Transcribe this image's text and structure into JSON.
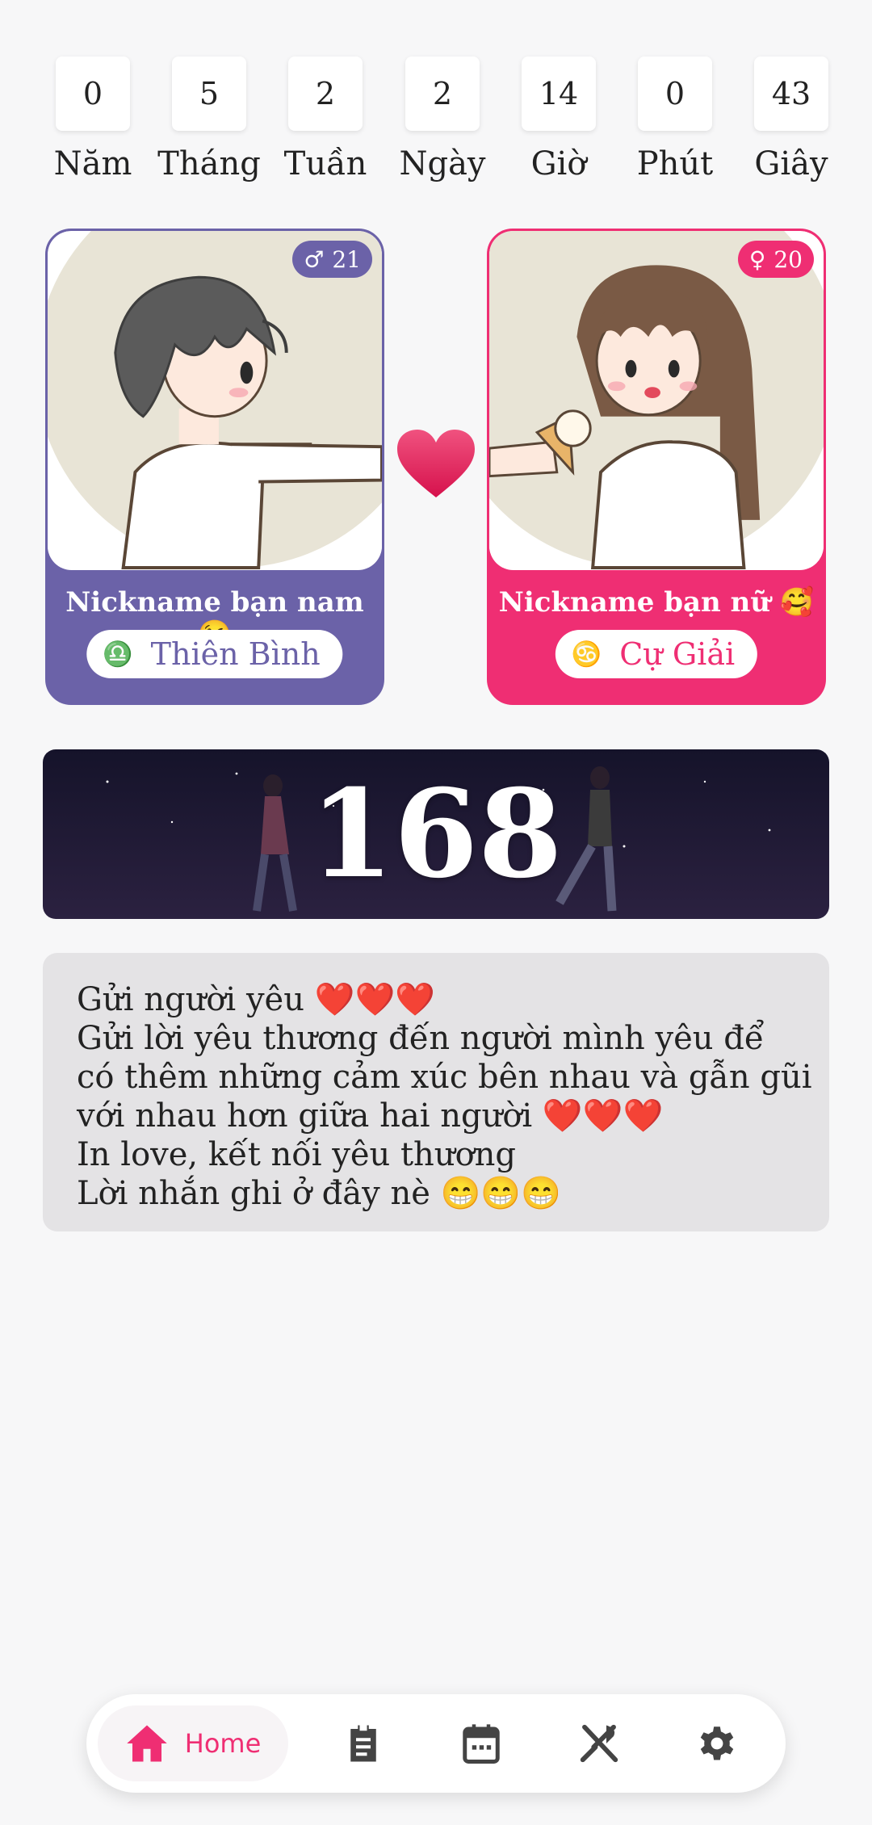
{
  "countdown": [
    {
      "value": "0",
      "label": "Năm"
    },
    {
      "value": "5",
      "label": "Tháng"
    },
    {
      "value": "2",
      "label": "Tuần"
    },
    {
      "value": "2",
      "label": "Ngày"
    },
    {
      "value": "14",
      "label": "Giờ"
    },
    {
      "value": "0",
      "label": "Phút"
    },
    {
      "value": "43",
      "label": "Giây"
    }
  ],
  "male": {
    "age": "21",
    "gender_symbol": "♂",
    "nickname": "Nickname bạn nam 😘",
    "zodiac_symbol": "♎",
    "zodiac": "Thiên Bình"
  },
  "female": {
    "age": "20",
    "gender_symbol": "♀",
    "nickname": "Nickname bạn nữ 🥰",
    "zodiac_symbol": "♋",
    "zodiac": "Cự Giải"
  },
  "days_together": "168",
  "message": {
    "lines": [
      "Gửi người yêu ❤️❤️❤️",
      "Gửi lời yêu thương đến người mình yêu để",
      "có thêm những cảm xúc bên nhau và gẫn gũi",
      "với nhau hơn giữa hai người ❤️❤️❤️",
      "In love, kết nối yêu thương",
      "Lời nhắn ghi ở đây nè 😁😁😁"
    ]
  },
  "nav": {
    "home_label": "Home",
    "active_color": "#ef2e73",
    "icon_color": "#444444",
    "items": [
      "home-icon",
      "clipboard-icon",
      "calendar-icon",
      "fork-knife-icon",
      "settings-icon"
    ]
  },
  "colors": {
    "male": "#6b62a8",
    "female": "#ef2e73",
    "background": "#f7f7f8"
  }
}
